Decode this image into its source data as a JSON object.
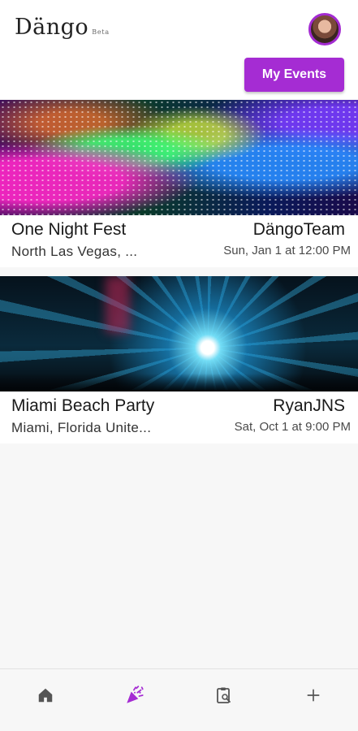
{
  "app": {
    "name": "Dängo",
    "badge": "Beta"
  },
  "header": {
    "my_events_label": "My Events",
    "avatar_alt": "User avatar"
  },
  "events": [
    {
      "title": "One Night Fest",
      "host": "DängoTeam",
      "location": "North Las Vegas, ...",
      "datetime": "Sun, Jan 1 at 12:00 PM",
      "image_icon": "concert-confetti-photo"
    },
    {
      "title": "Miami Beach Party",
      "host": "RyanJNS",
      "location": "Miami, Florida Unite...",
      "datetime": "Sat, Oct 1 at 9:00 PM",
      "image_icon": "club-laser-photo"
    }
  ],
  "bottom_nav": {
    "items": [
      {
        "icon": "home-icon",
        "active": false
      },
      {
        "icon": "party-popper-icon",
        "active": true
      },
      {
        "icon": "clipboard-search-icon",
        "active": false
      },
      {
        "icon": "plus-icon",
        "active": false
      }
    ]
  },
  "colors": {
    "accent": "#a52cd3",
    "icon_inactive": "#555555"
  }
}
